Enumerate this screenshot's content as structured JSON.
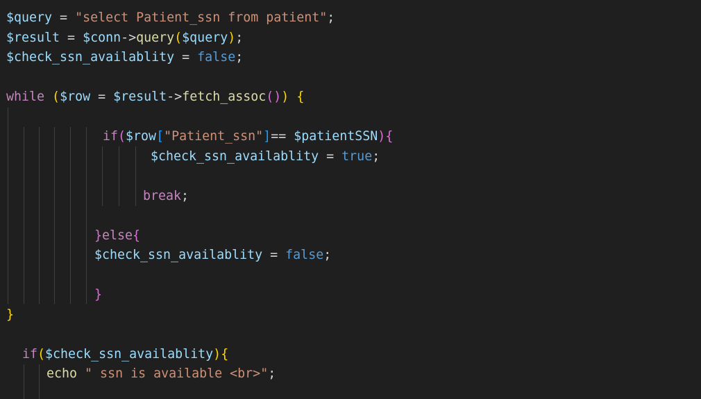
{
  "editor": {
    "language": "php",
    "theme_colors": {
      "background": "#1f1f1f",
      "variable": "#9cdcfe",
      "string": "#ce9178",
      "keyword": "#569cd6",
      "control": "#c586c0",
      "function": "#dcdcaa",
      "bracket_level1": "#ffd700",
      "bracket_level2": "#da70d6",
      "bracket_level3": "#179fff",
      "indent_guide": "#404040"
    },
    "lines": [
      "$query = \"select Patient_ssn from patient\";",
      "$result = $conn->query($query);",
      "$check_ssn_availablity = false;",
      "",
      "while ($row = $result->fetch_assoc()) {",
      "",
      "if($row[\"Patient_ssn\"]== $patientSSN){",
      "$check_ssn_availablity = true;",
      "",
      "break;",
      "",
      "}else{",
      "$check_ssn_availablity = false;",
      "",
      "}",
      "}",
      "",
      "if($check_ssn_availablity){",
      "echo \" ssn is available <br>\";"
    ]
  },
  "tokens": {
    "l1": [
      "$query",
      " = ",
      "\"select Patient_ssn from patient\"",
      ";"
    ],
    "l2": [
      "$result",
      " = ",
      "$conn",
      "->",
      "query",
      "(",
      "$query",
      ")",
      ";"
    ],
    "l3": [
      "$check_ssn_availablity",
      " = ",
      "false",
      ";"
    ],
    "l5": [
      "while",
      " ",
      "(",
      "$row",
      " = ",
      "$result",
      "->",
      "fetch_assoc",
      "(",
      ")",
      ")",
      " ",
      "{"
    ],
    "l7": [
      "if",
      "(",
      "$row",
      "[",
      "\"Patient_ssn\"",
      "]",
      "== ",
      "$patientSSN",
      ")",
      "{"
    ],
    "l8": [
      "$check_ssn_availablity",
      " = ",
      "true",
      ";"
    ],
    "l10": [
      "break",
      ";"
    ],
    "l12": [
      "}",
      "else",
      "{"
    ],
    "l13": [
      "$check_ssn_availablity",
      " = ",
      "false",
      ";"
    ],
    "l15": [
      "}"
    ],
    "l16": [
      "}"
    ],
    "l18": [
      "if",
      "(",
      "$check_ssn_availablity",
      ")",
      "{"
    ],
    "l19": [
      "echo",
      " ",
      "\" ssn is available <br>\"",
      ";"
    ]
  }
}
